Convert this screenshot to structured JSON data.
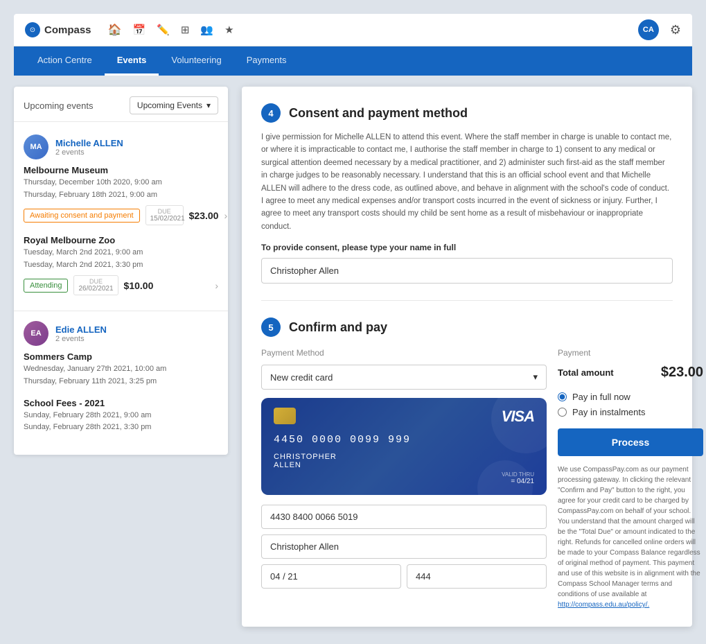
{
  "app": {
    "logo_text": "Compass",
    "avatar_initials": "CA",
    "gear_label": "⚙"
  },
  "top_nav": {
    "icons": [
      "🏠",
      "📅",
      "✏️",
      "⋮⋮⋮",
      "👥",
      "★"
    ]
  },
  "tabs": [
    {
      "id": "action-centre",
      "label": "Action Centre",
      "active": false
    },
    {
      "id": "events",
      "label": "Events",
      "active": true
    },
    {
      "id": "volunteering",
      "label": "Volunteering",
      "active": false
    },
    {
      "id": "payments",
      "label": "Payments",
      "active": false
    }
  ],
  "events_panel": {
    "title": "Upcoming events",
    "dropdown_label": "Upcoming Events",
    "students": [
      {
        "name": "Michelle ALLEN",
        "events_count": "2 events",
        "initials": "MA",
        "events": [
          {
            "name": "Melbourne Museum",
            "dates": [
              "Thursday, December 10th 2020, 9:00 am",
              "Thursday, February 18th 2021, 9:00 am"
            ],
            "status": "Awaiting consent and payment",
            "status_type": "awaiting",
            "due_label": "Due",
            "due_date": "15/02/2021",
            "amount": "$23.00"
          },
          {
            "name": "Royal Melbourne Zoo",
            "dates": [
              "Tuesday, March 2nd 2021, 9:00 am",
              "Tuesday, March 2nd 2021, 3:30 pm"
            ],
            "status": "Attending",
            "status_type": "attending",
            "due_label": "Due",
            "due_date": "26/02/2021",
            "amount": "$10.00"
          }
        ]
      },
      {
        "name": "Edie ALLEN",
        "events_count": "2 events",
        "initials": "EA",
        "events": [
          {
            "name": "Sommers Camp",
            "dates": [
              "Wednesday, January 27th 2021, 10:00 am",
              "Thursday, February 11th 2021, 3:25 pm"
            ],
            "status": "",
            "status_type": "",
            "due_label": "",
            "due_date": "",
            "amount": ""
          },
          {
            "name": "School Fees - 2021",
            "dates": [
              "Sunday, February 28th 2021, 9:00 am",
              "Sunday, February 28th 2021, 3:30 pm"
            ],
            "status": "",
            "status_type": "",
            "due_label": "",
            "due_date": "",
            "amount": ""
          }
        ]
      }
    ]
  },
  "payment_form": {
    "step4": {
      "number": "4",
      "title": "Consent and payment method",
      "consent_text": "I give permission for Michelle ALLEN to attend this event. Where the staff member in charge is unable to contact me, or where it is impracticable to contact me, I authorise the staff member in charge to 1) consent to any medical or surgical attention deemed necessary by a medical practitioner, and 2) administer such first-aid as the staff member in charge judges to be reasonably necessary. I understand that this is an official school event and that Michelle ALLEN will adhere to the dress code, as outlined above, and behave in alignment with the school's code of conduct. I agree to meet any medical expenses and/or transport costs incurred in the event of sickness or injury. Further, I agree to meet any transport costs should my child be sent home as a result of misbehaviour or inappropriate conduct.",
      "consent_input_label": "To provide consent, please type your name in full",
      "consent_input_value": "Christopher Allen",
      "consent_input_placeholder": "Christopher Allen"
    },
    "step5": {
      "number": "5",
      "title": "Confirm and pay",
      "payment_method_label": "Payment Method",
      "dropdown_label": "New credit card",
      "card": {
        "brand": "VISA",
        "number": "4450 0000 0099 999",
        "holder": "CHRISTOPHER",
        "holder2": "ALLEN",
        "expiry_label": "VALID THRU",
        "expiry": "= 04/21"
      },
      "card_number_input": "4430 8400 0066 5019",
      "cardholder_input": "Christopher Allen",
      "expiry_input": "04 / 21",
      "cvv_input": "444",
      "payment_label": "Payment",
      "total_label": "Total amount",
      "total_amount": "$23.00",
      "pay_full_label": "Pay in full now",
      "pay_instalments_label": "Pay in instalments",
      "process_label": "Process",
      "disclaimer": "We use CompassPay.com as our payment processing gateway. In clicking the relevant \"Confirm and Pay\" button to the right, you agree for your credit card to be charged by CompassPay.com on behalf of your school. You understand that the amount charged will be the \"Total Due\" or amount indicated to the right. Refunds for cancelled online orders will be made to your Compass Balance regardless of original method of payment. This payment and use of this website is in alignment with the Compass School Manager terms and conditions of use available at",
      "disclaimer_link": "http://compass.edu.au/policy/."
    }
  }
}
